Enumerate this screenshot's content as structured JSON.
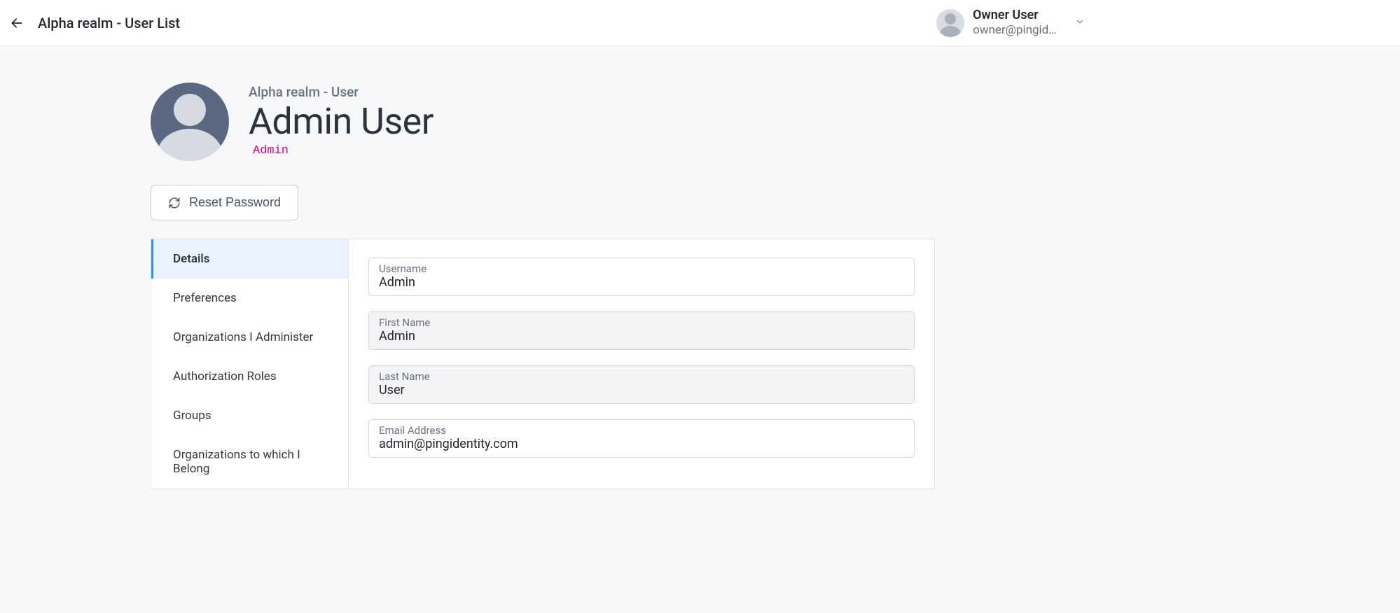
{
  "topbar": {
    "breadcrumb": "Alpha realm - User List",
    "user": {
      "name": "Owner User",
      "email": "owner@pingid…"
    }
  },
  "header": {
    "subtitle": "Alpha realm - User",
    "title": "Admin User",
    "badge": "Admin"
  },
  "actions": {
    "reset_password": "Reset Password"
  },
  "tabs": [
    {
      "label": "Details",
      "active": true
    },
    {
      "label": "Preferences",
      "active": false
    },
    {
      "label": "Organizations I Administer",
      "active": false
    },
    {
      "label": "Authorization Roles",
      "active": false
    },
    {
      "label": "Groups",
      "active": false
    },
    {
      "label": "Organizations to which I Belong",
      "active": false
    }
  ],
  "form": {
    "username": {
      "label": "Username",
      "value": "Admin",
      "readonly": false
    },
    "first_name": {
      "label": "First Name",
      "value": "Admin",
      "readonly": true
    },
    "last_name": {
      "label": "Last Name",
      "value": "User",
      "readonly": true
    },
    "email": {
      "label": "Email Address",
      "value": "admin@pingidentity.com",
      "readonly": false
    }
  }
}
